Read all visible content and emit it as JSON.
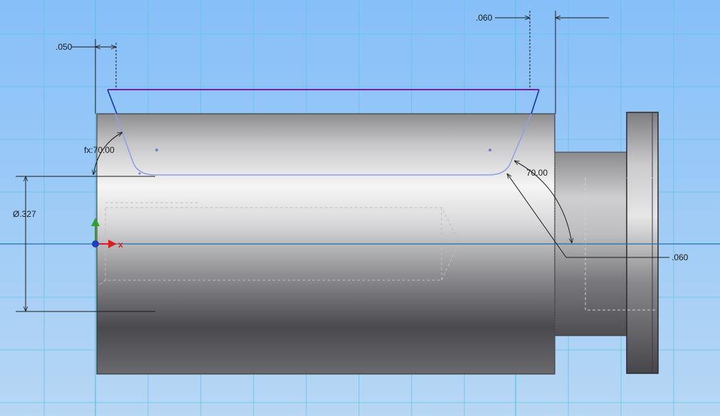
{
  "viewport": {
    "background_top": "#86bff9",
    "background_bottom": "#b7d7f4",
    "grid_color": "#5fc6e0",
    "axis_color": "#1f6fb0"
  },
  "part": {
    "body_light": "#f4f4f4",
    "body_dark": "#3e3e42",
    "edge_color": "#2b2b2b",
    "hidden_line_color": "#bdbdbd"
  },
  "sketch": {
    "profile_color": "#8fa0e6",
    "highlight_color": "#7a1fa0",
    "chamfer_color": "#1a2fa8"
  },
  "dimensions": {
    "left_offset": ".050",
    "right_offset": ".060",
    "left_angle": "fx:70.00",
    "right_angle": "70.00",
    "diameter": "Ø.327",
    "right_leader": ".060"
  },
  "triad": {
    "x_label": "x",
    "y_color": "#2fa02f",
    "x_color": "#d82020",
    "origin_color": "#1f3fbf"
  },
  "icons": {
    "origin": "origin-triad-icon",
    "center_point": "sketch-point-icon"
  }
}
